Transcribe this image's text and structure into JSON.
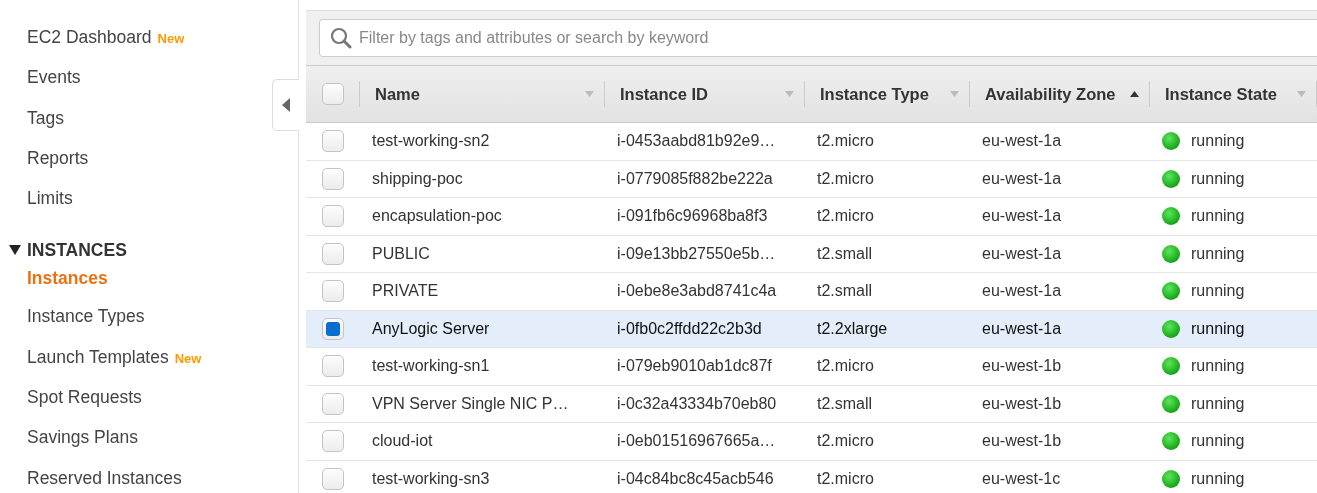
{
  "sidebar": {
    "items": [
      {
        "label": "EC2 Dashboard",
        "badge": "New",
        "selected": false
      },
      {
        "label": "Events",
        "selected": false
      },
      {
        "label": "Tags",
        "selected": false
      },
      {
        "label": "Reports",
        "selected": false
      },
      {
        "label": "Limits",
        "selected": false
      }
    ],
    "sections": [
      {
        "title": "INSTANCES",
        "expanded": true,
        "items": [
          {
            "label": "Instances",
            "selected": true
          },
          {
            "label": "Instance Types",
            "selected": false
          },
          {
            "label": "Launch Templates",
            "badge": "New",
            "selected": false
          },
          {
            "label": "Spot Requests",
            "selected": false
          },
          {
            "label": "Savings Plans",
            "selected": false
          },
          {
            "label": "Reserved Instances",
            "selected": false
          }
        ]
      }
    ]
  },
  "search": {
    "placeholder": "Filter by tags and attributes or search by keyword"
  },
  "table": {
    "select_all_checked": false,
    "columns": [
      {
        "label": "Name",
        "sorted": false
      },
      {
        "label": "Instance ID",
        "sorted": false
      },
      {
        "label": "Instance Type",
        "sorted": false
      },
      {
        "label": "Availability Zone",
        "sorted": true
      },
      {
        "label": "Instance State",
        "sorted": false
      }
    ],
    "rows": [
      {
        "cells": [
          "test-working-sn2",
          "i-0453aabd81b92e9…",
          "t2.micro",
          "eu-west-1a",
          "running"
        ],
        "selected": false
      },
      {
        "cells": [
          "shipping-poc",
          "i-0779085f882be222a",
          "t2.micro",
          "eu-west-1a",
          "running"
        ],
        "selected": false
      },
      {
        "cells": [
          "encapsulation-poc",
          "i-091fb6c96968ba8f3",
          "t2.micro",
          "eu-west-1a",
          "running"
        ],
        "selected": false
      },
      {
        "cells": [
          "PUBLIC",
          "i-09e13bb27550e5b…",
          "t2.small",
          "eu-west-1a",
          "running"
        ],
        "selected": false
      },
      {
        "cells": [
          "PRIVATE",
          "i-0ebe8e3abd8741c4a",
          "t2.small",
          "eu-west-1a",
          "running"
        ],
        "selected": false
      },
      {
        "cells": [
          "AnyLogic Server",
          "i-0fb0c2ffdd22c2b3d",
          "t2.2xlarge",
          "eu-west-1a",
          "running"
        ],
        "selected": true
      },
      {
        "cells": [
          "test-working-sn1",
          "i-079eb9010ab1dc87f",
          "t2.micro",
          "eu-west-1b",
          "running"
        ],
        "selected": false
      },
      {
        "cells": [
          "VPN Server Single NIC P…",
          "i-0c32a43334b70eb80",
          "t2.small",
          "eu-west-1b",
          "running"
        ],
        "selected": false
      },
      {
        "cells": [
          "cloud-iot",
          "i-0eb01516967665a…",
          "t2.micro",
          "eu-west-1b",
          "running"
        ],
        "selected": false
      },
      {
        "cells": [
          "test-working-sn3",
          "i-04c84bc8c45acb546",
          "t2.micro",
          "eu-west-1c",
          "running"
        ],
        "selected": false
      }
    ]
  }
}
